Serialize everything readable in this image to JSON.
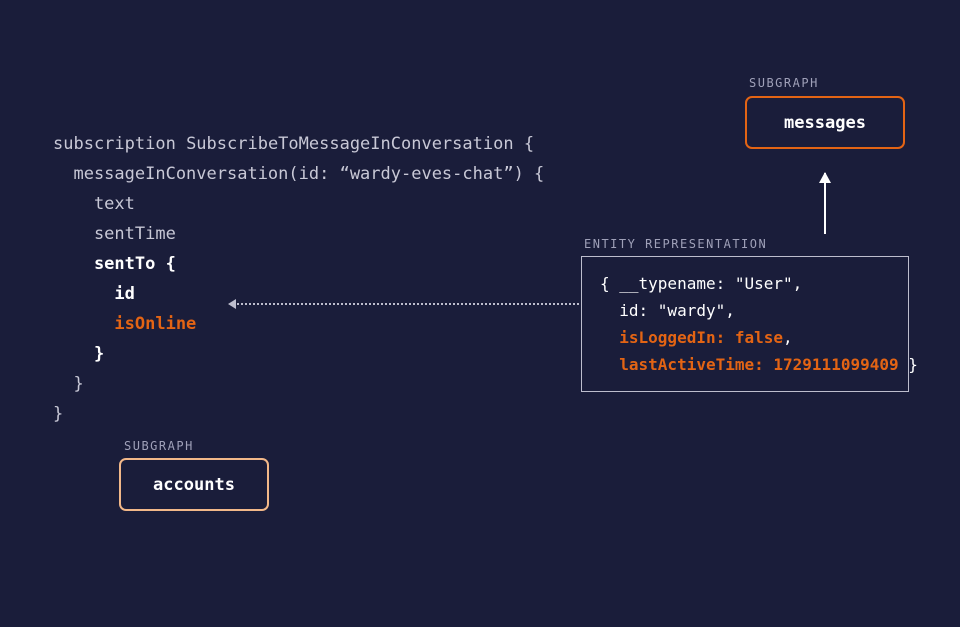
{
  "code": {
    "l1a": "subscription ",
    "l1b": "SubscribeToMessageInConversation {",
    "l2a": "  messageInConversation(id: ",
    "l2b": "“wardy-eves-chat”",
    "l2c": ") {",
    "l3": "    text",
    "l4": "    sentTime",
    "l5": "    sentTo {",
    "l6": "      id",
    "l7": "      isOnline",
    "l8": "    }",
    "l9": "  }",
    "l10": "}"
  },
  "labels": {
    "subgraph": "SUBGRAPH",
    "entity_rep": "ENTITY REPRESENTATION"
  },
  "boxes": {
    "messages": "messages",
    "accounts": "accounts"
  },
  "entity": {
    "r1": "{ __typename: \"User\",",
    "r2": "  id: \"wardy\",",
    "r3a": "  ",
    "r3b": "isLoggedIn: false",
    "r3c": ",",
    "r4a": "  ",
    "r4b": "lastActiveTime: 1729111099409",
    "r4c": " }"
  }
}
